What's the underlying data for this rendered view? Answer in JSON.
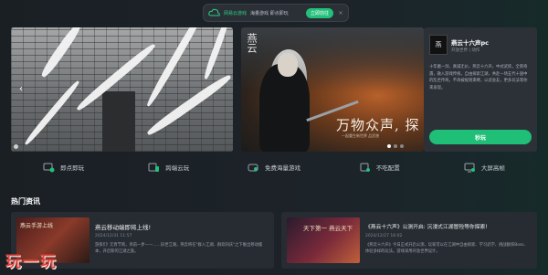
{
  "banner": {
    "brand": "网易云游戏",
    "slogan": "海量游戏 即点即玩",
    "download_label": "立即前往",
    "close_glyph": "×"
  },
  "hero_mid": {
    "big_title": "万物众声, 探",
    "sub_title": "一起重生新世界 品武侠",
    "logo_glyph": "燕云"
  },
  "game": {
    "icon_glyph": "燕",
    "title": "燕云十六声pc",
    "tags": "开放世界 | 动作",
    "description": "十年磨一剑，真诚无价。燕云十六声，中式武侠，全新奇遇，融入游戏传统，自由探索江湖，共赴一场五代十国中的乱世传奇。不再被规则束缚，以武会友，更多玩法等你来发现。",
    "play_label": "秒玩"
  },
  "features": [
    {
      "label": "即点即玩",
      "icon": "cloud-play-icon"
    },
    {
      "label": "跨端云玩",
      "icon": "multi-device-icon"
    },
    {
      "label": "免费海量游戏",
      "icon": "gamepad-icon"
    },
    {
      "label": "不吃配置",
      "icon": "chip-icon"
    },
    {
      "label": "大屏高帧",
      "icon": "screen-icon"
    }
  ],
  "news_section": {
    "title": "热门资讯"
  },
  "news": [
    {
      "title": "燕云移动端即将上线!",
      "date": "2024/12/31 11:57",
      "body": "游侠们! 元宵节到，目前一步——……旧世江湖，燕云将在\"群入江湖、群欢同庆\"之下推出移动版本，开启新的江湖之旅。",
      "thumb_text": "燕云手游上线"
    },
    {
      "title": "《燕云十六声》公测开启: 沉浸式江湖冒险等你探索!",
      "date": "2024/12/27 16:02",
      "body": "《燕云十六声》今日正式开启公测，玩家可以在江湖中自由探索、学习武学、挑战群侠Boss、体验多样的玩法。游戏采用开放世界设计。",
      "thumb_text": "天下第一 燕云天下"
    }
  ],
  "watermark": "玩一玩",
  "colors": {
    "accent": "#1fbf78",
    "bg": "#1a1f24",
    "card": "#2b3137"
  }
}
